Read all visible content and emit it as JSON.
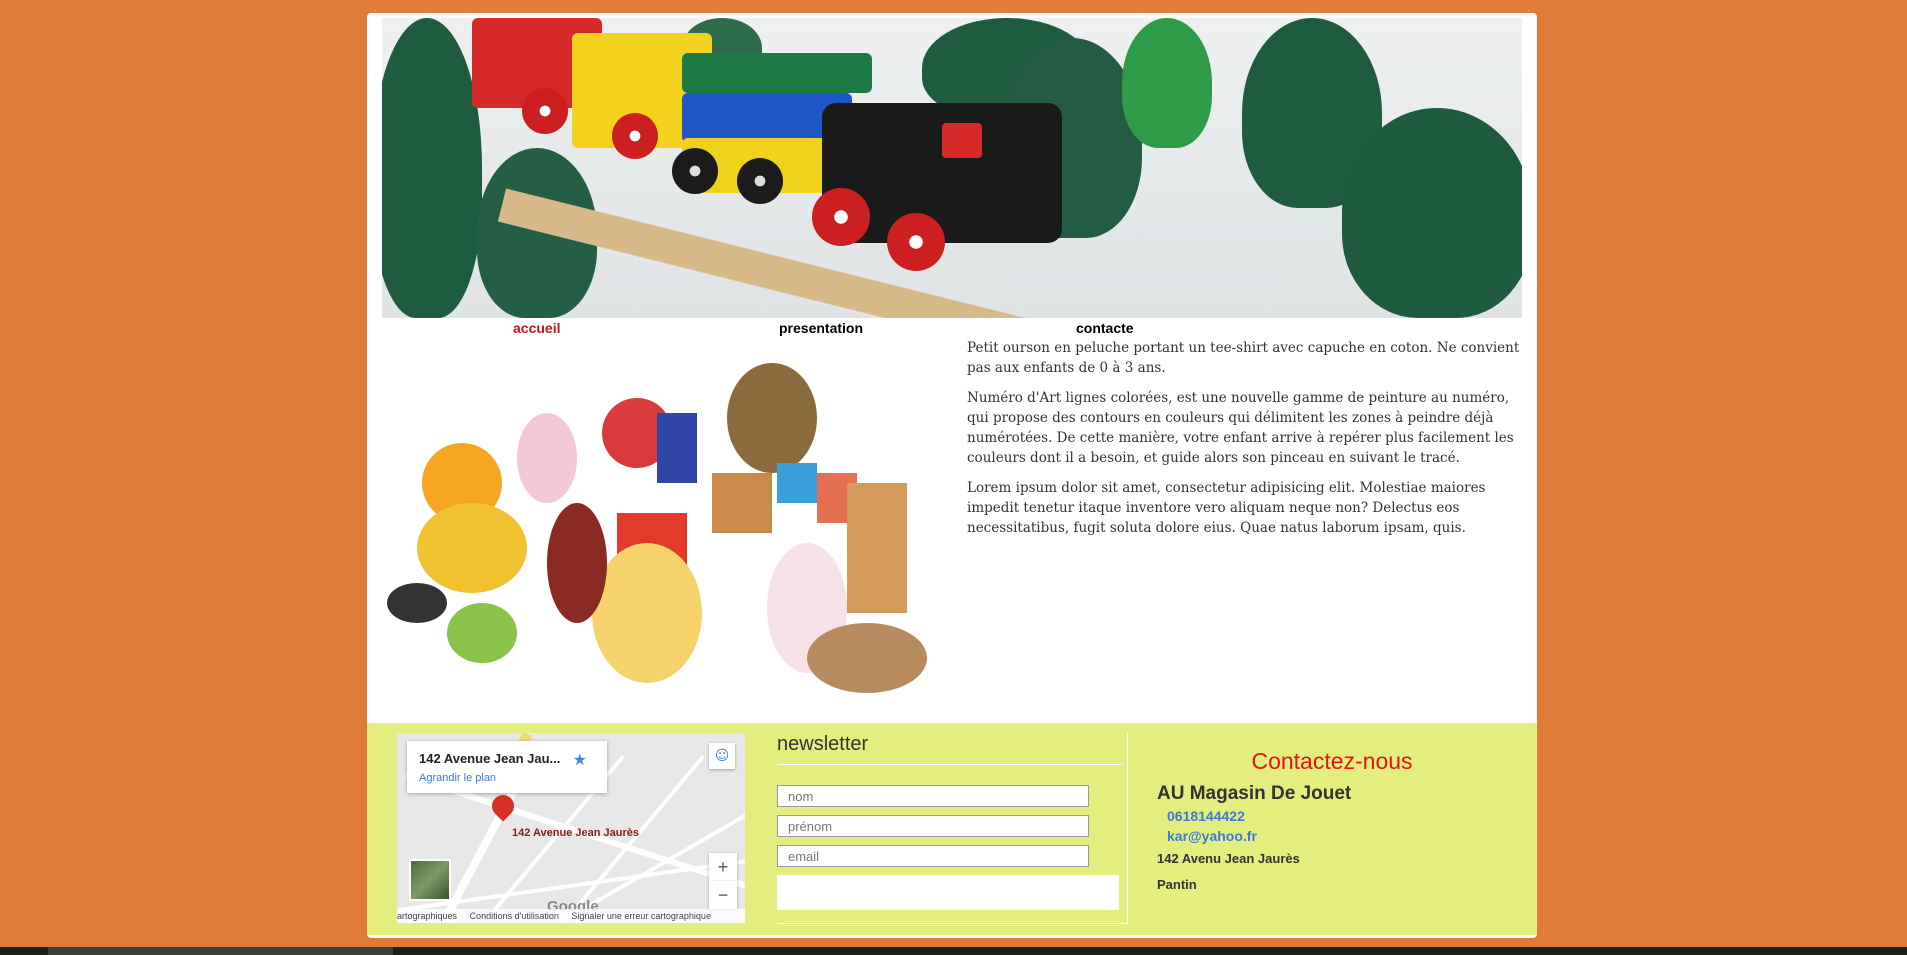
{
  "nav": {
    "items": [
      {
        "label": "accueil",
        "active": true
      },
      {
        "label": "presentation",
        "active": false
      },
      {
        "label": "contacte",
        "active": false
      }
    ]
  },
  "content": {
    "paragraphs": [
      "Petit ourson en peluche portant un tee-shirt avec capuche en coton. Ne convient pas aux enfants de 0 à 3 ans.",
      "Numéro d'Art lignes colorées, est une nouvelle gamme de peinture au numéro, qui propose des contours en couleurs qui délimitent les zones à peindre déjà numérotées. De cette manière, votre enfant arrive à repérer plus facilement les couleurs dont il a besoin, et guide alors son pinceau en suivant le tracé.",
      "Lorem ipsum dolor sit amet, consectetur adipisicing elit. Molestiae maiores impedit tenetur itaque inventore vero aliquam neque non? Delectus eos necessitatibus, fugit soluta dolore eius. Quae natus laborum ipsam, quis."
    ]
  },
  "map": {
    "card_title": "142 Avenue Jean Jau...",
    "card_link": "Agrandir le plan",
    "pin_label": "142 Avenue Jean Jaurès",
    "zoom_in": "+",
    "zoom_out": "−",
    "logo": "Google",
    "footer_items": [
      "artographiques",
      "Conditions d'utilisation",
      "Signaler une erreur cartographique"
    ]
  },
  "newsletter": {
    "title": "newsletter",
    "fields": {
      "nom_placeholder": "nom",
      "prenom_placeholder": "prénom",
      "email_placeholder": "email"
    }
  },
  "contact": {
    "heading": "Contactez-nous",
    "shop_name": "AU Magasin De Jouet",
    "phone": "0618144422",
    "email": "kar@yahoo.fr",
    "address": "142 Avenu Jean Jaurès",
    "city": "Pantin"
  },
  "colors": {
    "background": "#e07b39",
    "footer": "#e4ee7e",
    "accent_red": "#e3121b",
    "link_blue": "#3a7bd5"
  }
}
